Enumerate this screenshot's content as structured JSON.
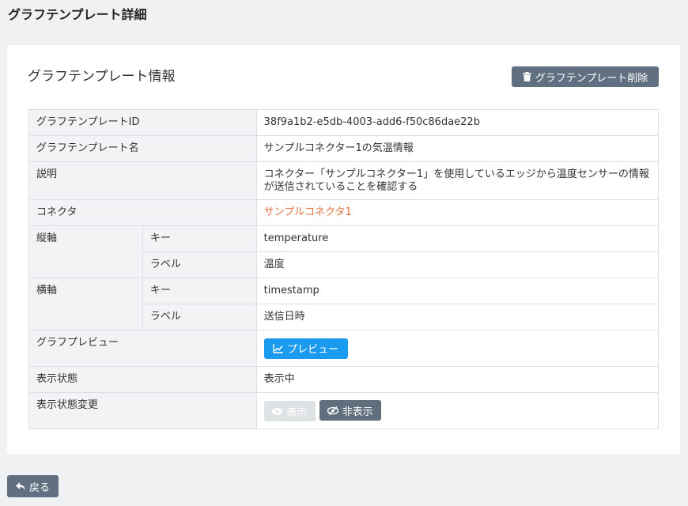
{
  "page": {
    "title": "グラフテンプレート詳細"
  },
  "card": {
    "title": "グラフテンプレート情報",
    "delete_label": "グラフテンプレート削除"
  },
  "rows": {
    "id": {
      "label": "グラフテンプレートID",
      "value": "38f9a1b2-e5db-4003-add6-f50c86dae22b"
    },
    "name": {
      "label": "グラフテンプレート名",
      "value": "サンプルコネクター1の気温情報"
    },
    "description": {
      "label": "説明",
      "value": "コネクター「サンプルコネクター1」を使用しているエッジから温度センサーの情報が送信されていることを確認する"
    },
    "connector": {
      "label": "コネクタ",
      "value": "サンプルコネクタ1"
    },
    "y_axis": {
      "label": "縦軸",
      "key_label": "キー",
      "key_value": "temperature",
      "label_label": "ラベル",
      "label_value": "温度"
    },
    "x_axis": {
      "label": "横軸",
      "key_label": "キー",
      "key_value": "timestamp",
      "label_label": "ラベル",
      "label_value": "送信日時"
    },
    "preview": {
      "label": "グラフプレビュー",
      "button_label": "プレビュー"
    },
    "status": {
      "label": "表示状態",
      "value": "表示中"
    },
    "status_change": {
      "label": "表示状態変更",
      "show_label": "表示",
      "hide_label": "非表示"
    }
  },
  "footer": {
    "back_label": "戻る"
  },
  "colors": {
    "accent_link": "#e7733c",
    "primary_button": "#1a9bf0",
    "secondary_button": "#607080"
  }
}
